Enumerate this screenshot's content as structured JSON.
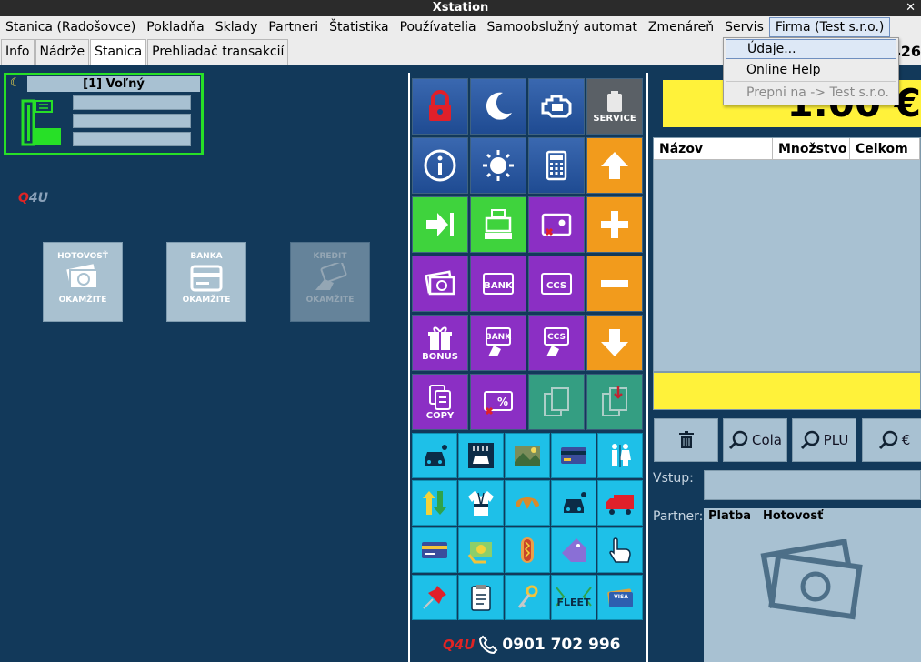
{
  "window": {
    "title": "Xstation",
    "close_glyph": "✕"
  },
  "menu": [
    {
      "label": "Stanica (Radošovce)"
    },
    {
      "label": "Pokladňa"
    },
    {
      "label": "Sklady"
    },
    {
      "label": "Partneri"
    },
    {
      "label": "Štatistika"
    },
    {
      "label": "Používatelia"
    },
    {
      "label": "Samoobslužný automat"
    },
    {
      "label": "Zmenáreň"
    },
    {
      "label": "Servis"
    },
    {
      "label": "Firma (Test s.r.o.)"
    }
  ],
  "tabs": [
    {
      "label": "Info"
    },
    {
      "label": "Nádrže"
    },
    {
      "label": "Stanica"
    },
    {
      "label": "Prehliadač transakcií"
    }
  ],
  "tab_right_number": "426",
  "dropdown": {
    "items": [
      {
        "label": "Údaje..."
      },
      {
        "label": "Online Help"
      },
      {
        "label": "Prepni na -> Test s.r.o."
      }
    ]
  },
  "pump": {
    "title": "[1] Voľný"
  },
  "brand": {
    "q": "Q",
    "rest": "4U"
  },
  "payment_buttons": [
    {
      "top": "HOTOVOSŤ",
      "bottom": "OKAMŽITE"
    },
    {
      "top": "BANKA",
      "bottom": "OKAMŽITE"
    },
    {
      "top": "KREDIT",
      "bottom": "OKAMŽITE"
    }
  ],
  "grid_labels": {
    "service": "SERVICE",
    "bank": "BANK",
    "ccs": "CCS",
    "bonus": "BONUS",
    "copy": "COPY",
    "fleet": "FLEET",
    "visa": "VISA"
  },
  "footer": {
    "logo": "Q4U",
    "phone": "0901 702 996"
  },
  "total": "1.00 €",
  "items_table": {
    "columns": [
      "Názov",
      "Množstvo",
      "Celkom"
    ]
  },
  "actions": {
    "cola": "Cola",
    "plu": "PLU",
    "euro": "€"
  },
  "vstup_label": "Vstup:",
  "partner_label": "Partner:",
  "platba_label": "Platba",
  "platba_value": "Hotovosť",
  "colors": {
    "accent_blue": "#1f4b92",
    "orange": "#f29b1c",
    "purple": "#8b2fc4",
    "green": "#3fd33d",
    "cyan": "#1ec0e8",
    "yellow": "#fff23a",
    "pump_border": "#27e027"
  }
}
